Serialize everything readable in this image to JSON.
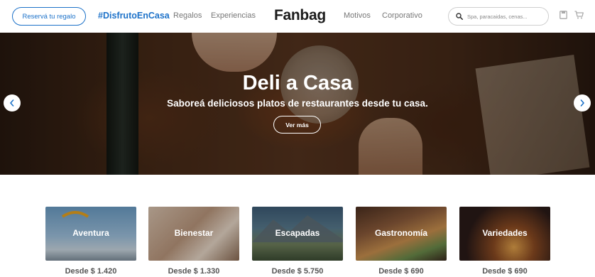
{
  "header": {
    "reserve_button": "Reservá tu regalo",
    "hashtag": "#DisfrutoEnCasa",
    "nav": [
      "Regalos",
      "Experiencias",
      "Motivos",
      "Corporativo"
    ],
    "logo": "Fanbag",
    "search_placeholder": "Spa, paracaidas, cenas...",
    "accent_color": "#1d72c9"
  },
  "hero": {
    "title": "Deli a Casa",
    "subtitle": "Saboreá deliciosos platos de restaurantes desde tu casa.",
    "button": "Ver más"
  },
  "categories": [
    {
      "name": "Aventura",
      "price": "Desde $ 1.420"
    },
    {
      "name": "Bienestar",
      "price": "Desde $ 1.330"
    },
    {
      "name": "Escapadas",
      "price": "Desde $ 5.750"
    },
    {
      "name": "Gastronomía",
      "price": "Desde $ 690"
    },
    {
      "name": "Variedades",
      "price": "Desde $ 690"
    }
  ]
}
